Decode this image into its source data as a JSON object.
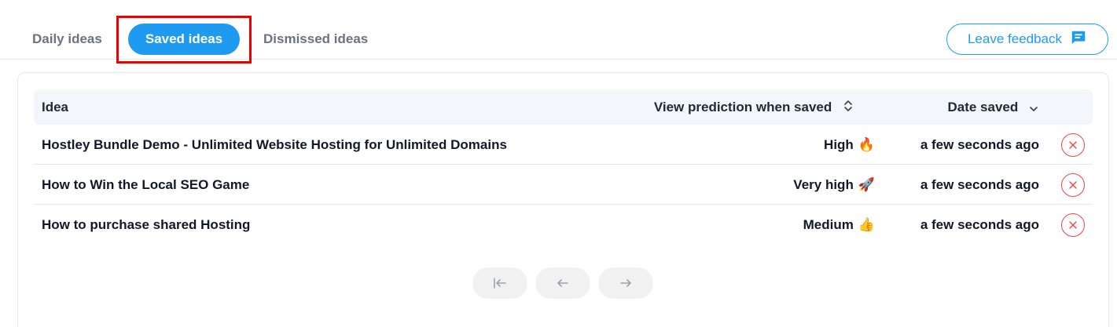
{
  "tabs": {
    "daily": "Daily ideas",
    "saved": "Saved ideas",
    "dismissed": "Dismissed ideas"
  },
  "feedback": {
    "label": "Leave feedback",
    "icon": "chat-icon"
  },
  "table": {
    "headers": {
      "idea": "Idea",
      "prediction": "View prediction when saved",
      "date": "Date saved"
    },
    "rows": [
      {
        "title": "Hostley Bundle Demo - Unlimited Website Hosting for Unlimited Domains",
        "prediction": "High",
        "emoji": "🔥",
        "date": "a few seconds ago"
      },
      {
        "title": "How to Win the Local SEO Game",
        "prediction": "Very high",
        "emoji": "🚀",
        "date": "a few seconds ago"
      },
      {
        "title": "How to purchase shared Hosting",
        "prediction": "Medium",
        "emoji": "👍",
        "date": "a few seconds ago"
      }
    ]
  },
  "pagination": {
    "first_icon": "first-page-icon",
    "prev_icon": "arrow-left-icon",
    "next_icon": "arrow-right-icon"
  },
  "colors": {
    "accent": "#1e9bf0",
    "highlight": "#ee0000",
    "danger": "#ef4444"
  }
}
